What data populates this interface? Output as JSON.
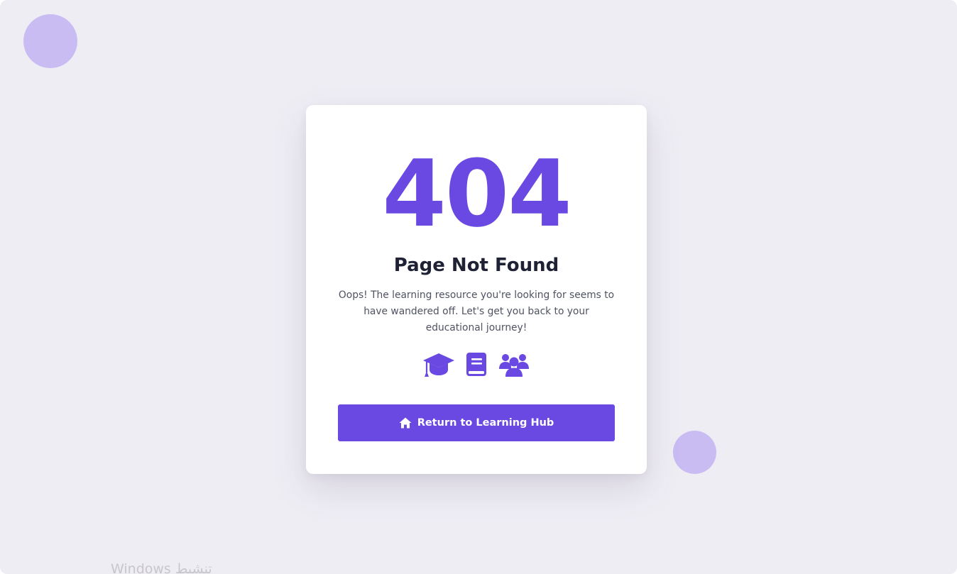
{
  "error": {
    "code": "404",
    "title": "Page Not Found",
    "message": "Oops! The learning resource you're looking for seems to have wandered off. Let's get you back to your educational journey!"
  },
  "icons": [
    "graduation-cap-icon",
    "book-icon",
    "users-icon"
  ],
  "button": {
    "label": "Return to Learning Hub",
    "icon": "home-icon"
  },
  "watermark": "Windows تنشيط",
  "colors": {
    "accent": "#6a48e2",
    "background": "#efedf4",
    "bubble": "#c9bcf2",
    "heading": "#1f2235",
    "body_text": "#4f5362"
  }
}
